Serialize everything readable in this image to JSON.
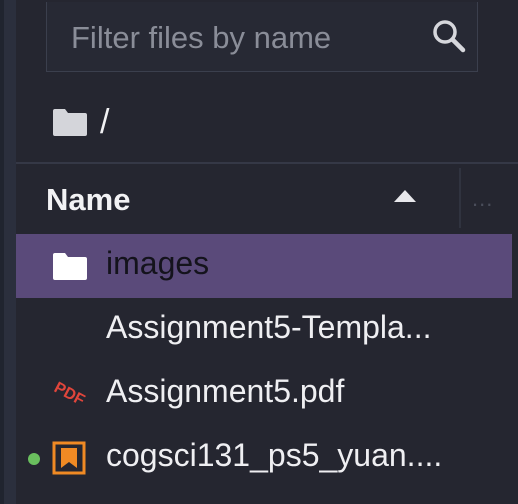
{
  "search": {
    "placeholder": "Filter files by name",
    "icon": "search-icon"
  },
  "breadcrumb": {
    "icon": "folder-icon",
    "path": "/"
  },
  "table_header": {
    "name_label": "Name",
    "sort_direction": "ascending",
    "more_label": "..."
  },
  "files": [
    {
      "name": "images",
      "icon": "folder-icon",
      "selected": true
    },
    {
      "name": "Assignment5-Templa...",
      "icon": "none",
      "selected": false
    },
    {
      "name": "Assignment5.pdf",
      "icon": "pdf-icon",
      "selected": false
    },
    {
      "name": "cogsci131_ps5_yuan....",
      "icon": "notebook-icon",
      "selected": false,
      "running": true
    }
  ],
  "colors": {
    "background": "#252630",
    "selected_row": "#5a4a7a",
    "pdf_icon": "#e0453b",
    "notebook_icon": "#f08a24",
    "running_dot": "#6abf5e"
  }
}
